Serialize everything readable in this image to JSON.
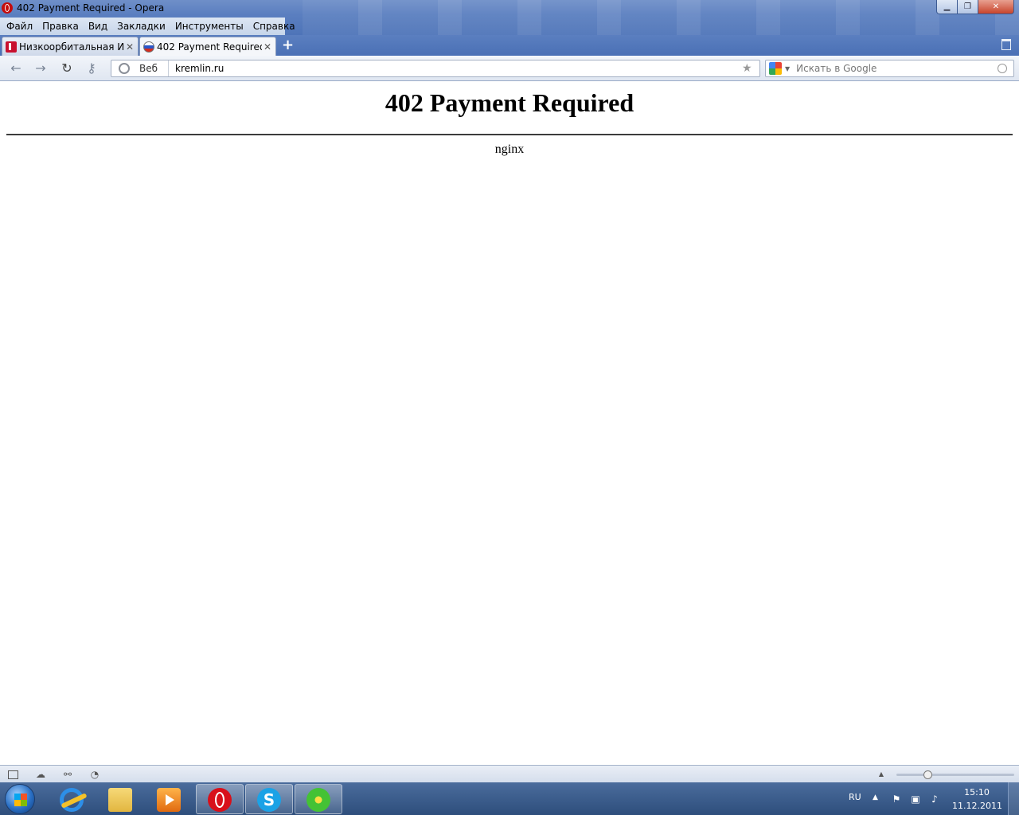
{
  "window": {
    "title": "402 Payment Required - Opera",
    "controls": {
      "minimize": "▁",
      "maximize": "❐",
      "close": "✕"
    }
  },
  "menu": {
    "items": [
      "Файл",
      "Правка",
      "Вид",
      "Закладки",
      "Инструменты",
      "Справка"
    ]
  },
  "tabs": [
    {
      "label": "Низкоорбитальная И...",
      "close": "✕",
      "favicon": "red-tab-favicon",
      "active": false
    },
    {
      "label": "402 Payment Required",
      "close": "✕",
      "favicon": "russian-flag-favicon",
      "active": true
    }
  ],
  "new_tab_label": "+",
  "toolbar": {
    "back": "←",
    "forward": "→",
    "reload": "↻",
    "key": "⚷",
    "web_label": "Веб",
    "url": "kremlin.ru",
    "bookmark_star": "★",
    "search_placeholder": "Искать в Google",
    "search_dropdown": "▼"
  },
  "page": {
    "heading": "402 Payment Required",
    "server": "nginx"
  },
  "statusbar": {
    "icons": [
      "panel-toggle-icon",
      "unite-cloud-icon",
      "turbo-icon",
      "speed-dial-icon"
    ],
    "zoom_arrow": "▲",
    "zoom_level_fraction": 0.27
  },
  "taskbar": {
    "apps": [
      "Internet Explorer",
      "Windows Explorer",
      "Windows Media Player",
      "Opera",
      "Skype",
      "ICQ"
    ],
    "skype_letter": "S",
    "tray_lang": "RU",
    "tray_arrow": "▲",
    "clock_time": "15:10",
    "clock_date": "11.12.2011"
  },
  "colors": {
    "title_gradient_top": "#6f8fc8",
    "taskbar": "#2e4e7c",
    "opera_red": "#d8101a"
  }
}
